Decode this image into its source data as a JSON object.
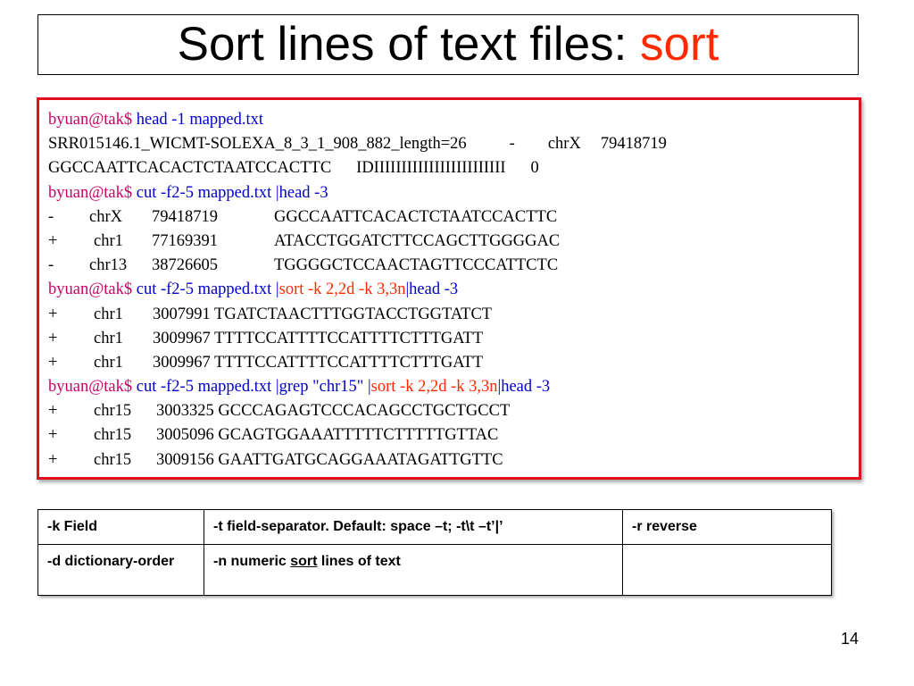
{
  "title": {
    "text": "Sort lines of text files: ",
    "command": "sort"
  },
  "terminal": {
    "prompt": "byuan@tak$",
    "cmd1": "head -1 mapped.txt",
    "out1": {
      "a": "SRR015146.1_WICMT-SOLEXA_8_3_1_908_882_length=26",
      "b": "-",
      "c": "chrX",
      "d": "79418719",
      "e": "GGCCAATTCACACTCTAATCCACTTC",
      "f": "IDIIIIIIIIIIIIIIIIIIIIIIII",
      "g": "0"
    },
    "cmd2": "cut -f2-5 mapped.txt |head -3",
    "out2": [
      {
        "strand": "-",
        "chr": "chrX",
        "pos": "79418719",
        "seq": "GGCCAATTCACACTCTAATCCACTTC"
      },
      {
        "strand": "+",
        "chr": "chr1",
        "pos": "77169391",
        "seq": "ATACCTGGATCTTCCAGCTTGGGGAC"
      },
      {
        "strand": "-",
        "chr": "chr13",
        "pos": "38726605",
        "seq": "TGGGGCTCCAACTAGTTCCCATTCTC"
      }
    ],
    "cmd3_a": "cut -f2-5 mapped.txt |",
    "cmd3_sort": "sort -k 2,2d -k 3,3n",
    "cmd3_b": "|head -3",
    "out3": [
      {
        "strand": "+",
        "chr": "chr1",
        "pos": "3007991",
        "seq": "TGATCTAACTTTGGTACCTGGTATCT"
      },
      {
        "strand": "+",
        "chr": "chr1",
        "pos": "3009967",
        "seq": "TTTTCCATTTTCCATTTTCTTTGATT"
      },
      {
        "strand": "+",
        "chr": "chr1",
        "pos": "3009967",
        "seq": "TTTTCCATTTTCCATTTTCTTTGATT"
      }
    ],
    "cmd4_a": "cut -f2-5 mapped.txt |grep \"chr15\" |",
    "cmd4_sort": "sort -k 2,2d -k 3,3n",
    "cmd4_b": "|head -3",
    "out4": [
      {
        "strand": "+",
        "chr": "chr15",
        "pos": "3003325",
        "seq": "GCCCAGAGTCCCACAGCCTGCTGCCT"
      },
      {
        "strand": "+",
        "chr": "chr15",
        "pos": "3005096",
        "seq": "GCAGTGGAAATTTTTCTTTTTGTTAC"
      },
      {
        "strand": "+",
        "chr": "chr15",
        "pos": "3009156",
        "seq": "GAATTGATGCAGGAAATAGATTGTTC"
      }
    ]
  },
  "options_table": {
    "row1": [
      "-k Field",
      "-t field-separator. Default: space  –t;   -t\\t  –t’|’",
      "-r reverse"
    ],
    "row2_c1": "-d dictionary-order",
    "row2_c2_a": "-n numeric ",
    "row2_c2_sort": "sort",
    "row2_c2_b": " lines of text",
    "row2_c3": ""
  },
  "colors": {
    "prompt": "#cc0066",
    "command": "#0000cc",
    "sort_highlight": "#ff2a00",
    "frame": "#e0101c"
  },
  "page_number": "14"
}
